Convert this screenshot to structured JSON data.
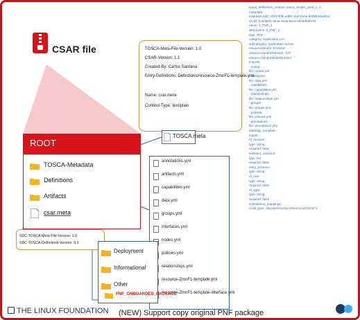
{
  "csar": {
    "title": "CSAR file"
  },
  "root": {
    "label": "ROOT",
    "items": [
      "TOSCA-Metadata",
      "Definitions",
      "Artifacts",
      "csar.meta"
    ]
  },
  "meta_note": {
    "lines": [
      "TOSCA-Meta-File-Version: 1.0",
      "CSAR-Version: 1.1",
      "Created-By: Carlos Santana",
      "Entry-Definitions: Definitions/resource-ZmnF1-template.yml",
      "",
      "Name: csar.meta",
      "Content-Type: text/plain"
    ]
  },
  "tosca_meta_label": "TOSCA.meta",
  "sdc_note": {
    "lines": [
      "SDC-TOSCA-Meta-File-Version: 1.0",
      "SDC-TOSCA-Definitions-Version: 9.0"
    ]
  },
  "definitions_files": [
    "annotations.yml",
    "artifacts.yml",
    "capabilities.yml",
    "data.yml",
    "groups.yml",
    "interfaces.yml",
    "nodes.yml",
    "policies.yml",
    "relationships.yml",
    "resource-ZmnF1-template.yml",
    "resource-ZmnF1-template-interface.yml"
  ],
  "artifact_folders": [
    "Deployment",
    "Informational",
    "Other"
  ],
  "pnf_package_label": "PNF_ONBOARDED_PACKAGE",
  "yaml_lines": [
    "tosca_definitions_version: tosca_simple_yaml_1_1",
    "metadata:",
    "  invariantUUID: 3f34799b-ed83-41af-815a-808b63da4b14",
    "  UUID: 2c5db5f4-3b4a-46da-b8c2-45f3bfbdf079",
    "  name: 2_PNF_1",
    "  description: 2_PNF_1",
    "  type: PNF",
    "  category: Application L4+",
    "  subcategory: Application Server",
    "  resourceVendor: Ericsson",
    "  resourceVendorRelease: '1.0'",
    "  resourceVendorModelNumber: ''",
    "imports:",
    "- nodes:",
    "    file: nodes.yml",
    "- datatypes:",
    "    file: data.yml",
    "- capabilities:",
    "    file: capabilities.yml",
    "- relationships:",
    "    file: relationships.yml",
    "- groups:",
    "    file: groups.yml",
    "- policies:",
    "    file: policies.yml",
    "- annotations:",
    "    file: annotations.yml",
    "topology_template:",
    "  inputs:",
    "    nf_function:",
    "      type: string",
    "      required: false",
    "    software_versions:",
    "      type: list",
    "      required: false",
    "    entry_schema:",
    "      type: string",
    "    nf_role:",
    "      type: string",
    "      required: false",
    "    nf_type:",
    "      type: string",
    "      required: false",
    "  substitution_mappings:",
    "    node_type: org.openecomp.resource.pnf.ZmnF1"
  ],
  "footer": {
    "logo_text": "THE LINUX FOUNDATION",
    "caption": "(NEW) Support copy original PNF package"
  },
  "colors": {
    "accent_red": "#d8141a",
    "note_border": "#d99040",
    "link_blue": "#3366aa"
  }
}
